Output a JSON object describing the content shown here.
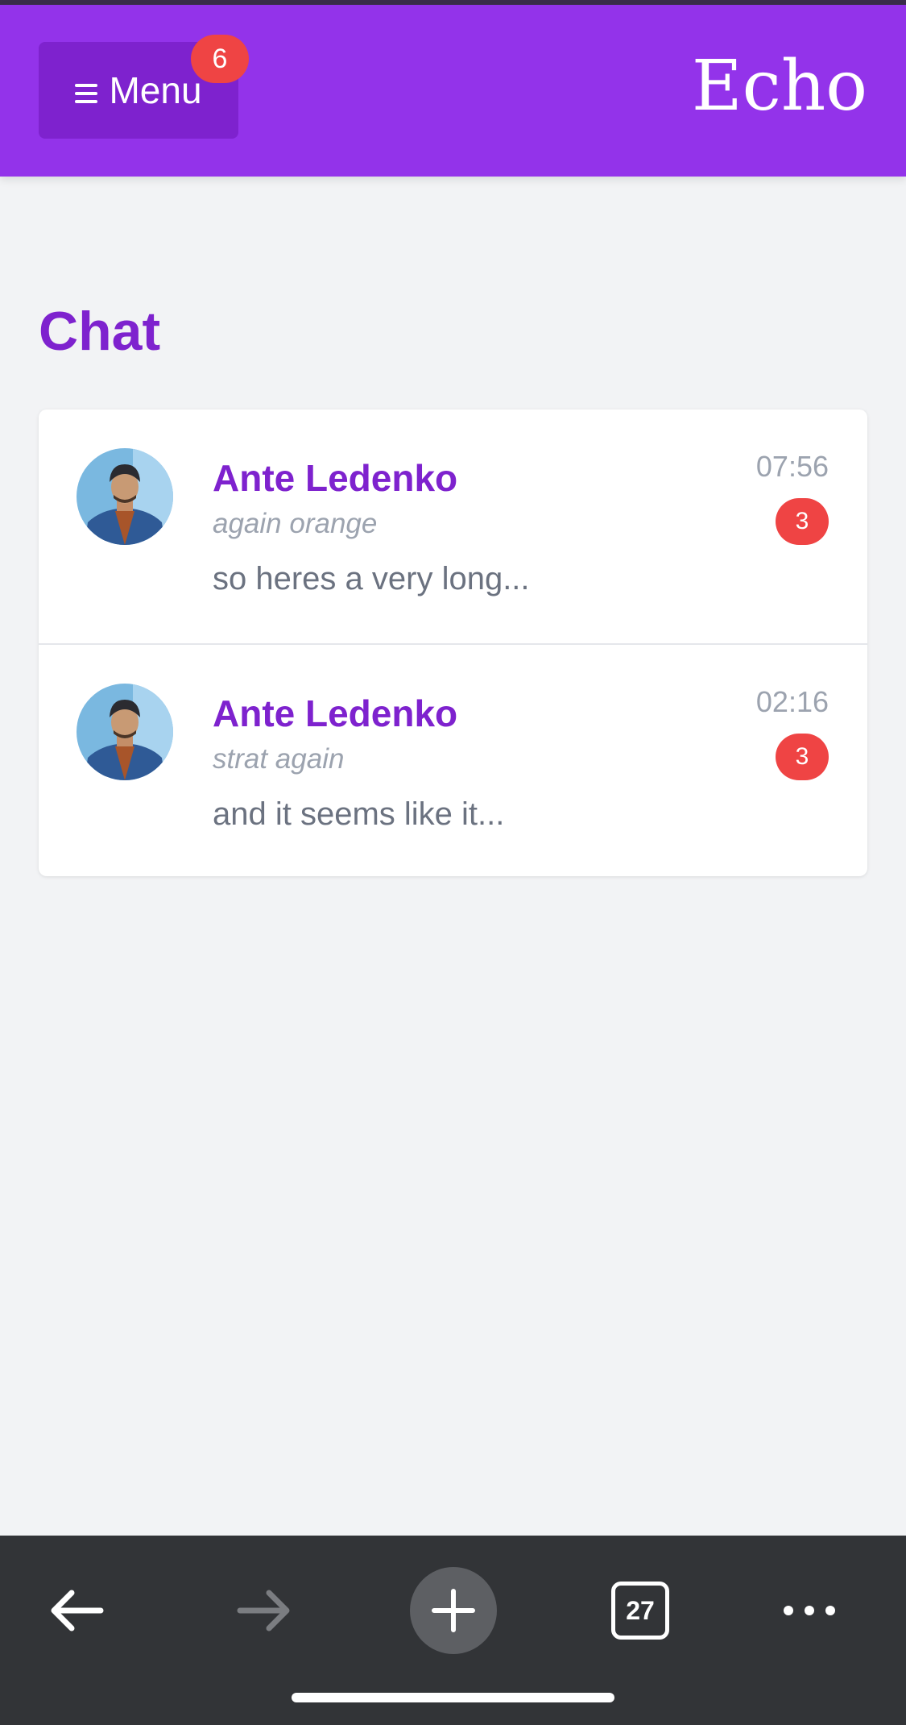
{
  "header": {
    "menu_label": "Menu",
    "menu_badge": "6",
    "brand": "Echo",
    "color": "#9333ea"
  },
  "page": {
    "title": "Chat"
  },
  "chats": [
    {
      "name": "Ante Ledenko",
      "subject": "again orange",
      "preview": "so heres a very long...",
      "time": "07:56",
      "unread": "3"
    },
    {
      "name": "Ante Ledenko",
      "subject": "strat again",
      "preview": "and it seems like it...",
      "time": "02:16",
      "unread": "3"
    }
  ],
  "browser_toolbar": {
    "tab_count": "27",
    "icons": [
      "back-arrow-icon",
      "forward-arrow-icon",
      "plus-icon",
      "tabs-icon",
      "more-dots-icon"
    ]
  },
  "colors": {
    "accent": "#7e22ce",
    "badge": "#ef4444",
    "toolbar": "#323437"
  }
}
